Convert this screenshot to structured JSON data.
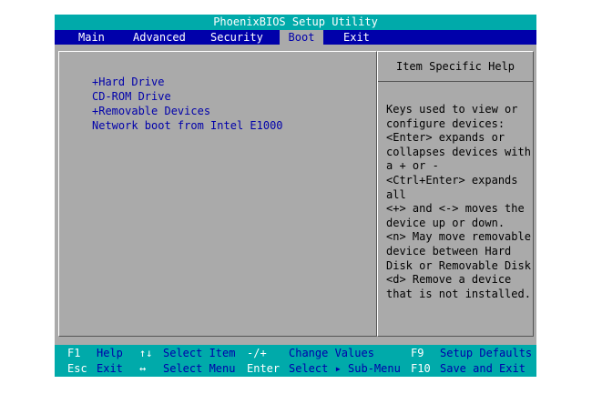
{
  "title": "PhoenixBIOS Setup Utility",
  "menu": [
    "Main",
    "Advanced",
    "Security",
    "Boot",
    "Exit"
  ],
  "active_menu": "Boot",
  "boot_items": [
    "+Hard Drive",
    "CD-ROM Drive",
    "+Removable Devices",
    "Network boot from Intel E1000"
  ],
  "help": {
    "title": "Item Specific Help",
    "lines": [
      "Keys used to view or",
      "configure devices:",
      "<Enter> expands or",
      "collapses devices with",
      "a + or -",
      "<Ctrl+Enter> expands",
      "all",
      "<+> and <-> moves the",
      "device up or down.",
      "<n> May move removable",
      "device between Hard",
      "Disk or Removable Disk",
      "<d> Remove a device",
      "that is not installed."
    ]
  },
  "footer": {
    "row1": [
      {
        "key": "F1",
        "desc": "Help"
      },
      {
        "key": "↑↓",
        "desc": "Select Item"
      },
      {
        "key": "-/+",
        "desc": "Change Values"
      },
      {
        "key": "F9",
        "desc": "Setup Defaults"
      }
    ],
    "row2": [
      {
        "key": "Esc",
        "desc": "Exit"
      },
      {
        "key": "↔",
        "desc": "Select Menu"
      },
      {
        "key": "Enter",
        "desc": "Select ▸ Sub-Menu"
      },
      {
        "key": "F10",
        "desc": "Save and Exit"
      }
    ]
  },
  "colors": {
    "background": "#aaaaaa",
    "title_bar": "#00aaaa",
    "menu_bar": "#0000aa",
    "item_text": "#0000aa",
    "help_text": "#000000"
  }
}
